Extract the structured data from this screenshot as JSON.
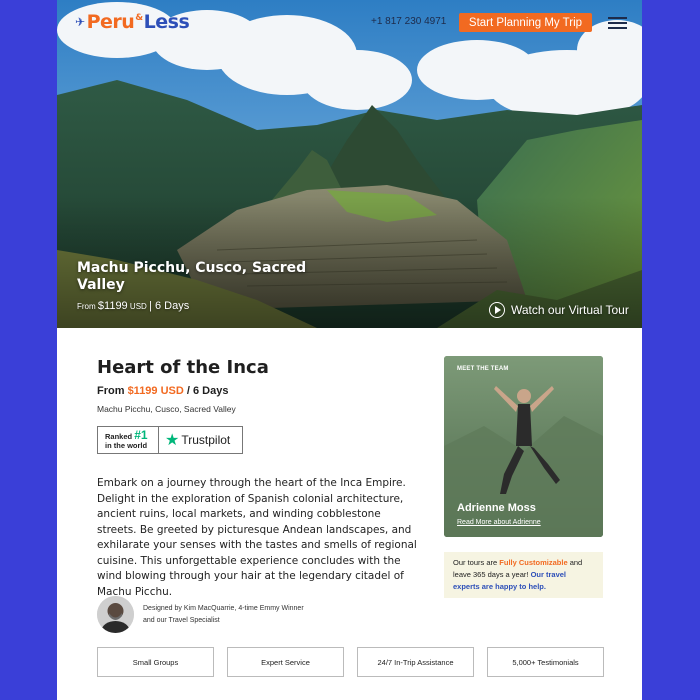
{
  "header": {
    "logo_text_1": "Peru",
    "logo_amp": "&",
    "logo_text_2": "Less",
    "phone": "+1 817 230 4971",
    "cta_label": "Start Planning My Trip"
  },
  "hero": {
    "title": "Machu Picchu, Cusco, Sacred Valley",
    "from_label": "From",
    "price": "$1199",
    "currency": "USD",
    "duration": "6 Days",
    "virtual_tour_label": "Watch our Virtual Tour"
  },
  "trip": {
    "title": "Heart of the Inca",
    "price_prefix": "From",
    "price": "$1199 USD",
    "duration_suffix": "/ 6 Days",
    "location": "Machu Picchu, Cusco, Sacred Valley",
    "badge_ranked": "Ranked",
    "badge_number": "#1",
    "badge_world": "in the world",
    "badge_brand": "Trustpilot",
    "description": "Embark on a journey through the heart of the Inca Empire. Delight in the exploration of Spanish colonial architecture, ancient ruins, local markets, and winding cobblestone streets. Be greeted by picturesque Andean landscapes, and exhilarate your senses with the tastes and smells of regional cuisine. This unforgettable experience concludes with the wind blowing through your hair at the legendary citadel of Machu Picchu.",
    "designer_line1": "Designed by Kim MacQuarrie, 4-time Emmy Winner",
    "designer_line2": "and our Travel Specialist"
  },
  "team_card": {
    "label": "MEET THE TEAM",
    "name": "Adrienne Moss",
    "link": "Read More about Adrienne"
  },
  "custom_box": {
    "t1": "Our tours are ",
    "t2": "Fully Customizable",
    "t3": " and leave 365 days a year! ",
    "t4": "Our travel experts are happy to help."
  },
  "features": [
    "Small Groups",
    "Expert Service",
    "24/7 In-Trip Assistance",
    "5,000+ Testimonials"
  ],
  "colors": {
    "background": "#3a3fd8",
    "accent": "#f26a21",
    "brand_blue": "#2d4fb8",
    "trustpilot_green": "#00b67a"
  },
  "icons": [
    "plane-icon",
    "menu-icon",
    "play-icon",
    "star-icon"
  ]
}
